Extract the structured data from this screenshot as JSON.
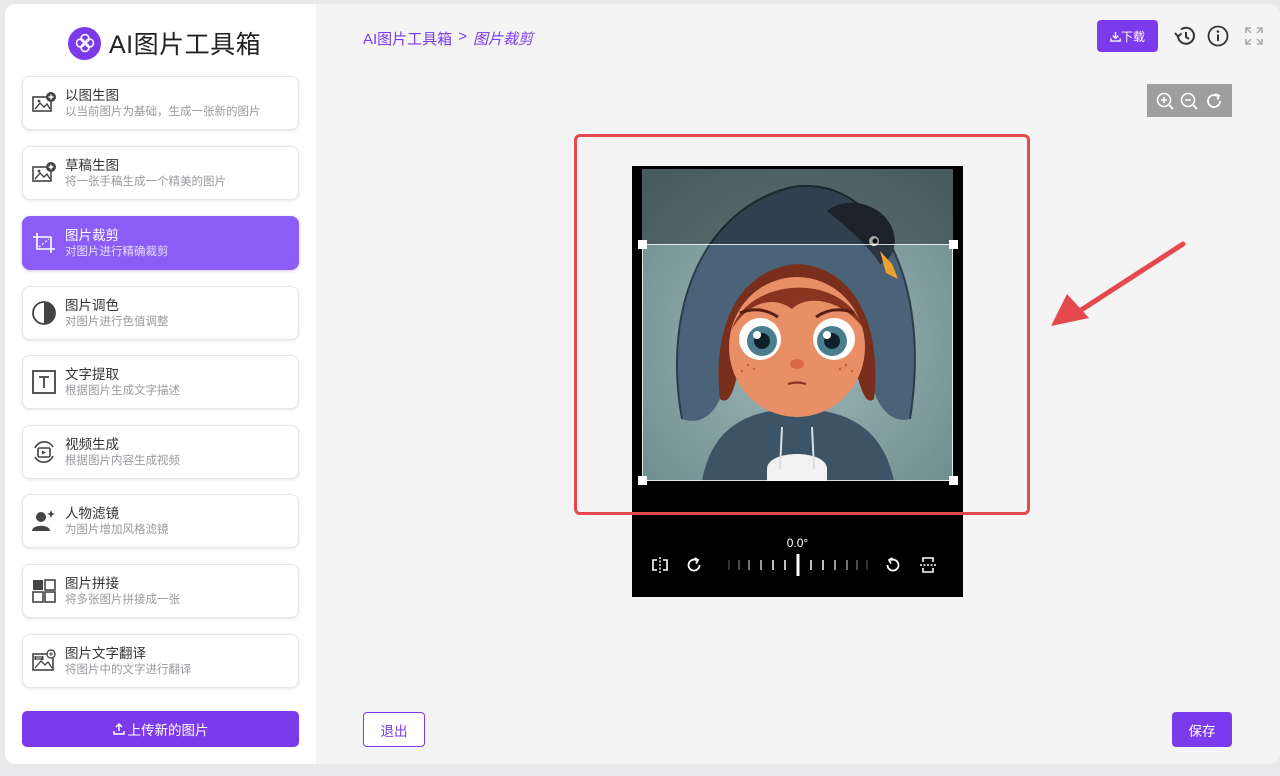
{
  "app": {
    "title": "AI图片工具箱"
  },
  "sidebar": {
    "items": [
      {
        "title": "以图生图",
        "desc": "以当前图片为基础，生成一张新的图片",
        "icon": "image-plus-icon",
        "active": false
      },
      {
        "title": "草稿生图",
        "desc": "将一张手稿生成一个精美的图片",
        "icon": "image-sparkle-icon",
        "active": false
      },
      {
        "title": "图片裁剪",
        "desc": "对图片进行精确裁剪",
        "icon": "crop-icon",
        "active": true
      },
      {
        "title": "图片调色",
        "desc": "对图片进行色值调整",
        "icon": "contrast-icon",
        "active": false
      },
      {
        "title": "文字提取",
        "desc": "根据图片生成文字描述",
        "icon": "text-icon",
        "active": false
      },
      {
        "title": "视频生成",
        "desc": "根据图片内容生成视频",
        "icon": "video-icon",
        "active": false
      },
      {
        "title": "人物滤镜",
        "desc": "为图片增加风格滤镜",
        "icon": "person-filter-icon",
        "active": false
      },
      {
        "title": "图片拼接",
        "desc": "将多张图片拼接成一张",
        "icon": "grid-icon",
        "active": false
      },
      {
        "title": "图片文字翻译",
        "desc": "将图片中的文字进行翻译",
        "icon": "image-text-icon",
        "active": false
      }
    ],
    "upload_label": "上传新的图片"
  },
  "breadcrumb": {
    "root": "AI图片工具箱",
    "separator": ">",
    "current": "图片裁剪"
  },
  "toolbar": {
    "download_label": "下载"
  },
  "editor": {
    "rotation_label": "0.0°"
  },
  "footer": {
    "exit_label": "退出",
    "save_label": "保存"
  },
  "colors": {
    "accent": "#7c3aed",
    "accent_light": "#8b5cf6",
    "highlight": "#e5484d"
  }
}
